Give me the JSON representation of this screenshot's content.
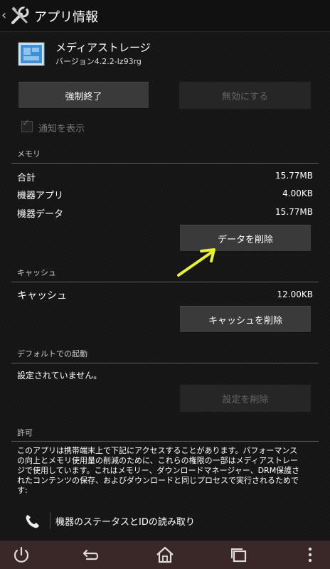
{
  "actionbar": {
    "title": "アプリ情報"
  },
  "app": {
    "name": "メディアストレージ",
    "version": "バージョン4.2.2-lz93rg"
  },
  "buttons": {
    "force_stop": "強制終了",
    "disable": "無効にする",
    "clear_data": "データを削除",
    "clear_cache": "キャッシュを削除",
    "clear_defaults": "設定を削除"
  },
  "notify": {
    "label": "通知を表示",
    "checked": true,
    "enabled": false
  },
  "memory": {
    "header": "メモリ",
    "rows": [
      {
        "label": "合計",
        "value": "15.77MB"
      },
      {
        "label": "機器アプリ",
        "value": "4.00KB"
      },
      {
        "label": "機器データ",
        "value": "15.77MB"
      }
    ]
  },
  "cache": {
    "header": "キャッシュ",
    "label": "キャッシュ",
    "value": "12.00KB"
  },
  "defaults": {
    "header": "デフォルトでの起動",
    "text": "設定されていません。"
  },
  "permissions": {
    "header": "許可",
    "desc_lines": [
      "このアプリは携帯端末上で下記にアクセスすることがあります。パフォーマンス",
      "の向上とメモリ使用量の削減のために、これらの権限の一部はメディアストレー",
      "ジで使用しています。これはメモリー、ダウンロードマネージャー、DRM保護さ",
      "れたコンテンツの保存、およびダウンロードと同じプロセスで実行されるためで",
      "す:"
    ],
    "item": "機器のステータスとIDの読み取り"
  },
  "colors": {
    "accent_arrow": "#e8f03a",
    "navbar": "#3a2727"
  },
  "icons": [
    "tools-icon",
    "media-storage-icon",
    "phone-icon",
    "power-icon",
    "back-icon",
    "home-icon",
    "recent-apps-icon",
    "menu-icon"
  ]
}
